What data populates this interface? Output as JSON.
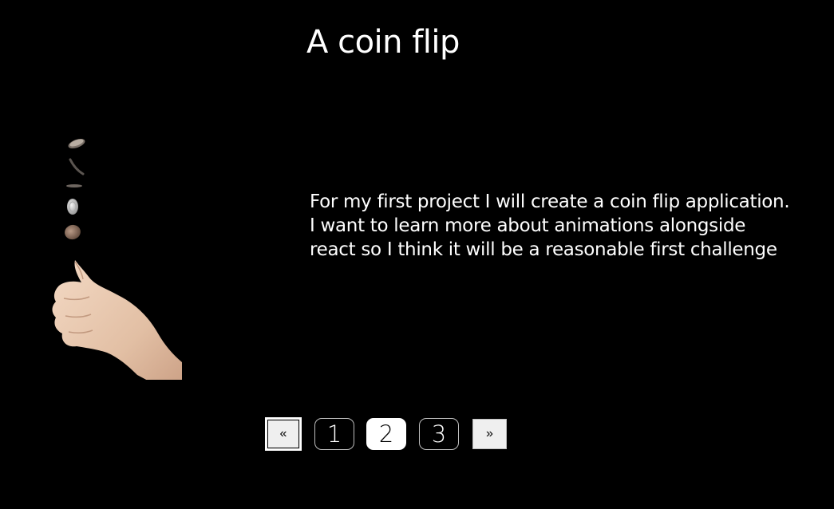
{
  "header": {
    "title": "A coin flip"
  },
  "project": {
    "illustration_icon": "coin-flip-hand-icon",
    "description": "For my first project I will create a coin flip application. I want to learn more about animations alongside react so I think it will be a reasonable first challenge"
  },
  "pagination": {
    "prev_label": "«",
    "next_label": "»",
    "pages": [
      "1",
      "2",
      "3"
    ],
    "current_page": "2"
  },
  "colors": {
    "background": "#000000",
    "text": "#ffffff",
    "active_page_bg": "#ffffff",
    "nav_button_bg": "#efefef"
  }
}
